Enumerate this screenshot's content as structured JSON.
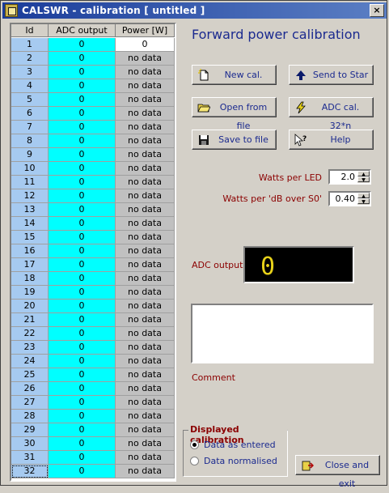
{
  "window": {
    "title": "CALSWR - calibration  [ untitled ]",
    "close_glyph": "×"
  },
  "heading": "Forward power calibration",
  "table": {
    "headers": [
      "Id",
      "ADC output",
      "Power [W]"
    ],
    "rows": [
      [
        "1",
        "0",
        "0"
      ],
      [
        "2",
        "0",
        "no data"
      ],
      [
        "3",
        "0",
        "no data"
      ],
      [
        "4",
        "0",
        "no data"
      ],
      [
        "5",
        "0",
        "no data"
      ],
      [
        "6",
        "0",
        "no data"
      ],
      [
        "7",
        "0",
        "no data"
      ],
      [
        "8",
        "0",
        "no data"
      ],
      [
        "9",
        "0",
        "no data"
      ],
      [
        "10",
        "0",
        "no data"
      ],
      [
        "11",
        "0",
        "no data"
      ],
      [
        "12",
        "0",
        "no data"
      ],
      [
        "13",
        "0",
        "no data"
      ],
      [
        "14",
        "0",
        "no data"
      ],
      [
        "15",
        "0",
        "no data"
      ],
      [
        "16",
        "0",
        "no data"
      ],
      [
        "17",
        "0",
        "no data"
      ],
      [
        "18",
        "0",
        "no data"
      ],
      [
        "19",
        "0",
        "no data"
      ],
      [
        "20",
        "0",
        "no data"
      ],
      [
        "21",
        "0",
        "no data"
      ],
      [
        "22",
        "0",
        "no data"
      ],
      [
        "23",
        "0",
        "no data"
      ],
      [
        "24",
        "0",
        "no data"
      ],
      [
        "25",
        "0",
        "no data"
      ],
      [
        "26",
        "0",
        "no data"
      ],
      [
        "27",
        "0",
        "no data"
      ],
      [
        "28",
        "0",
        "no data"
      ],
      [
        "29",
        "0",
        "no data"
      ],
      [
        "30",
        "0",
        "no data"
      ],
      [
        "31",
        "0",
        "no data"
      ],
      [
        "32",
        "0",
        "no data"
      ]
    ]
  },
  "buttons": {
    "new_cal": "New cal.",
    "send_to_star": "Send to Star",
    "open_from_file": "Open from file",
    "adc_cal": "ADC cal. 32*n",
    "save_to_file": "Save to file",
    "help": "Help",
    "close_and_exit": "Close and exit"
  },
  "fields": {
    "watts_per_led_label": "Watts per LED",
    "watts_per_led_value": "2.0",
    "watts_per_db_label": "Watts per 'dB over S0'",
    "watts_per_db_value": "0.40"
  },
  "adc_output_label": "ADC output",
  "adc_display_value": "0",
  "comment_label": "Comment",
  "comment_text": "",
  "displayed_calibration": {
    "caption": "Displayed calibration",
    "options": [
      "Data as entered",
      "Data normalised"
    ],
    "selected": "Data as entered"
  },
  "colors": {
    "heading": "#1b2a8f",
    "label": "#8b0000",
    "id_col": "#a6caf0",
    "adc_col": "#00ffff",
    "led": "#e8d21a"
  }
}
